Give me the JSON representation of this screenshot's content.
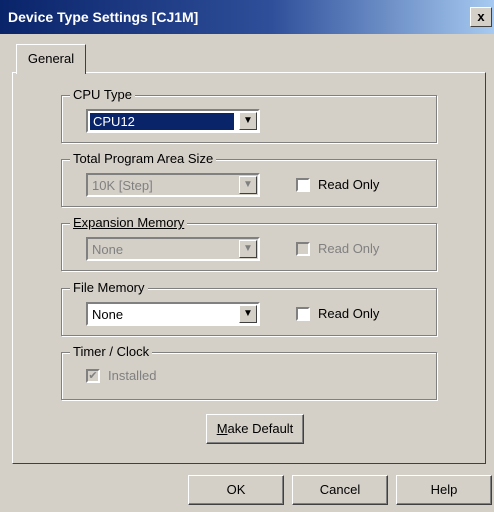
{
  "window": {
    "title": "Device Type Settings [CJ1M]",
    "close_label": "x"
  },
  "tabs": [
    {
      "label": "General"
    }
  ],
  "cpu_type": {
    "label": "CPU Type",
    "value": "CPU12"
  },
  "program_area": {
    "label": "Total Program Area Size",
    "value": "10K [Step]",
    "read_only_label": "Read Only",
    "read_only_checked": false
  },
  "expansion_memory": {
    "label": "Expansion Memory",
    "value": "None",
    "read_only_label": "Read Only",
    "read_only_checked": false
  },
  "file_memory": {
    "label": "File Memory",
    "value": "None",
    "read_only_label": "Read Only",
    "read_only_checked": false
  },
  "timer_clock": {
    "label": "Timer / Clock",
    "installed_label": "Installed",
    "installed_checked": true
  },
  "buttons": {
    "make_default_prefix": "M",
    "make_default_rest": "ake Default",
    "ok": "OK",
    "cancel": "Cancel",
    "help": "Help"
  },
  "icons": {
    "dropdown": "chevron-down-icon",
    "check": "check-icon",
    "close": "close-icon"
  }
}
